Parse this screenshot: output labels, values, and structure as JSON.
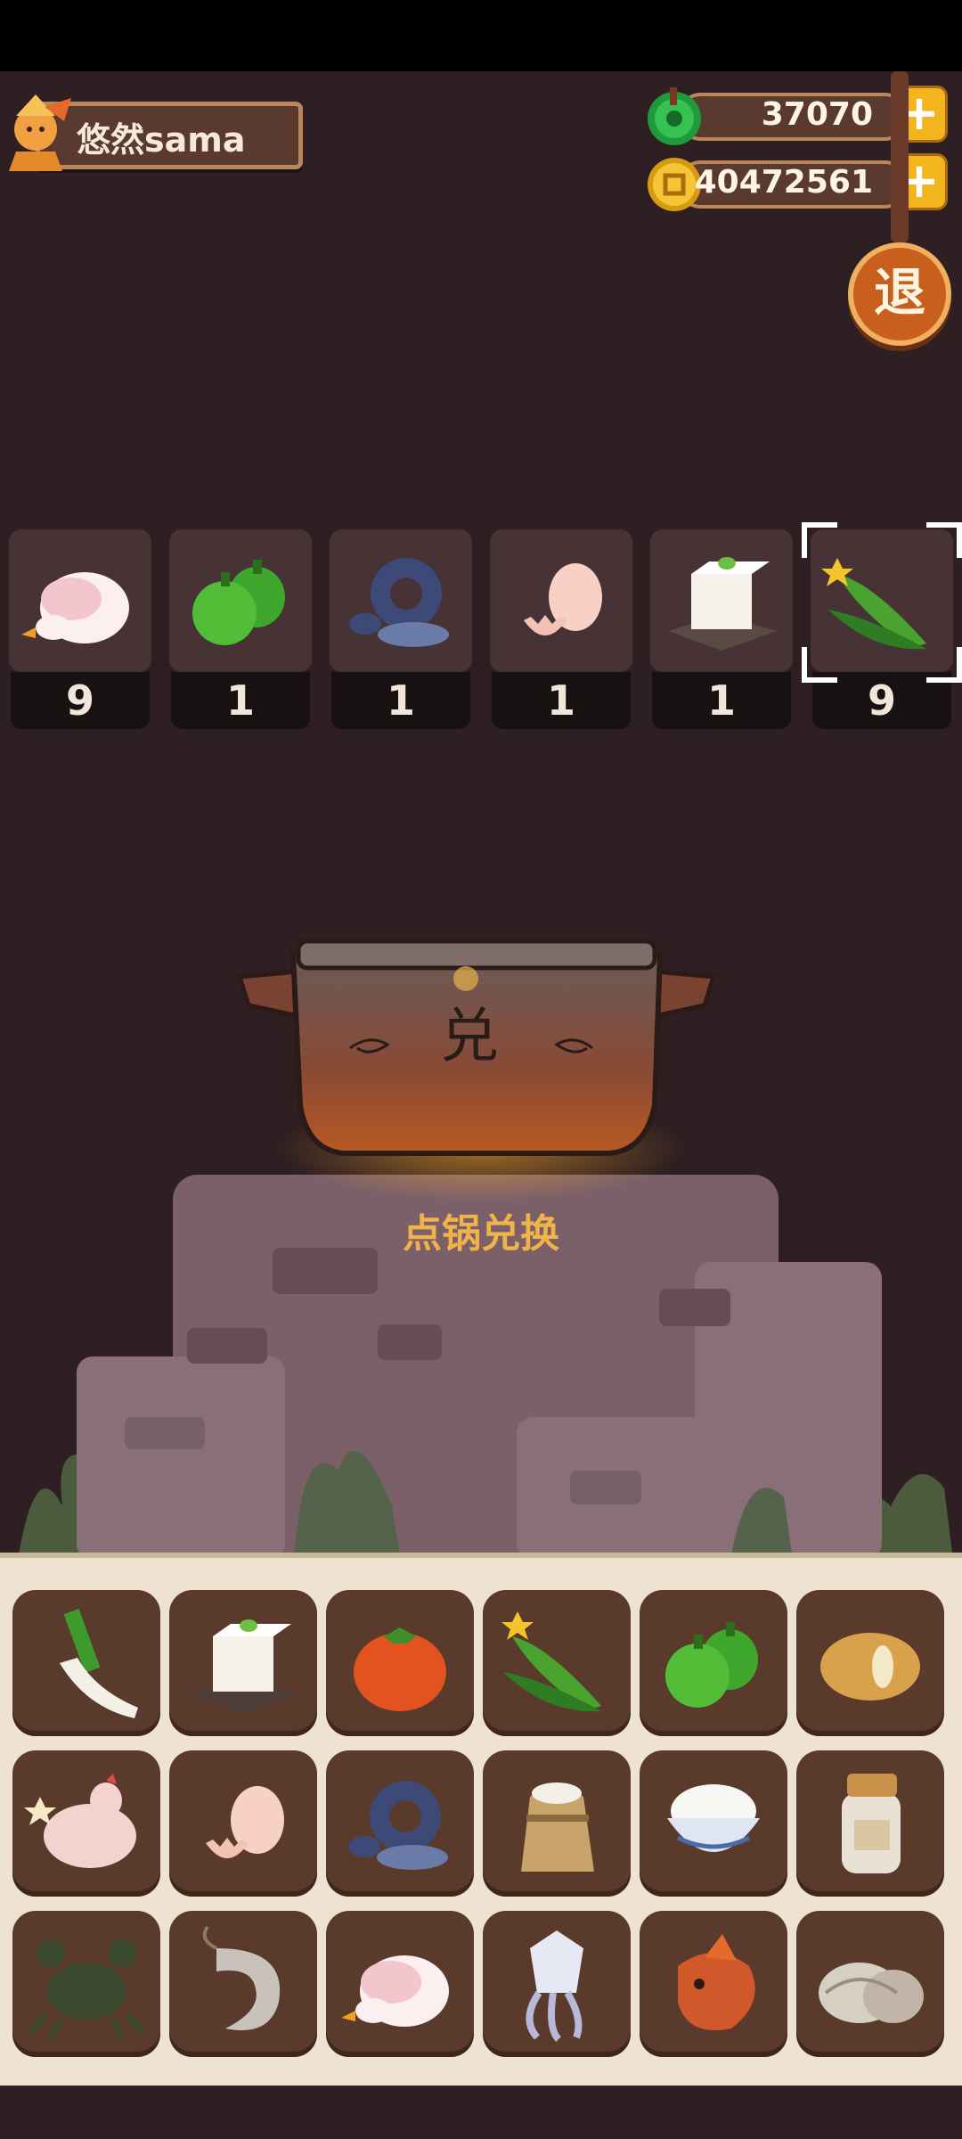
{
  "player": {
    "name": "悠然sama"
  },
  "currency": {
    "jade": {
      "value": "37070",
      "icon": "jade-icon"
    },
    "coins": {
      "value": "40472561",
      "icon": "coin-icon"
    }
  },
  "exit_button": {
    "label": "退"
  },
  "selected_items": [
    {
      "item": "goose",
      "count": "9"
    },
    {
      "item": "green-pepper",
      "count": "1"
    },
    {
      "item": "eel-fish",
      "count": "1"
    },
    {
      "item": "egg",
      "count": "1"
    },
    {
      "item": "tofu",
      "count": "1"
    },
    {
      "item": "cucumber",
      "count": "9"
    }
  ],
  "pot": {
    "character": "兑",
    "hint": "点锅兑换"
  },
  "inventory": [
    "leek",
    "tofu",
    "tomato",
    "cucumber",
    "green-pepper",
    "potato",
    "chicken",
    "egg",
    "eel-fish",
    "flour-sack",
    "rice-bowl",
    "jar",
    "crab",
    "shrimp",
    "goose",
    "squid",
    "carp",
    "clam"
  ]
}
